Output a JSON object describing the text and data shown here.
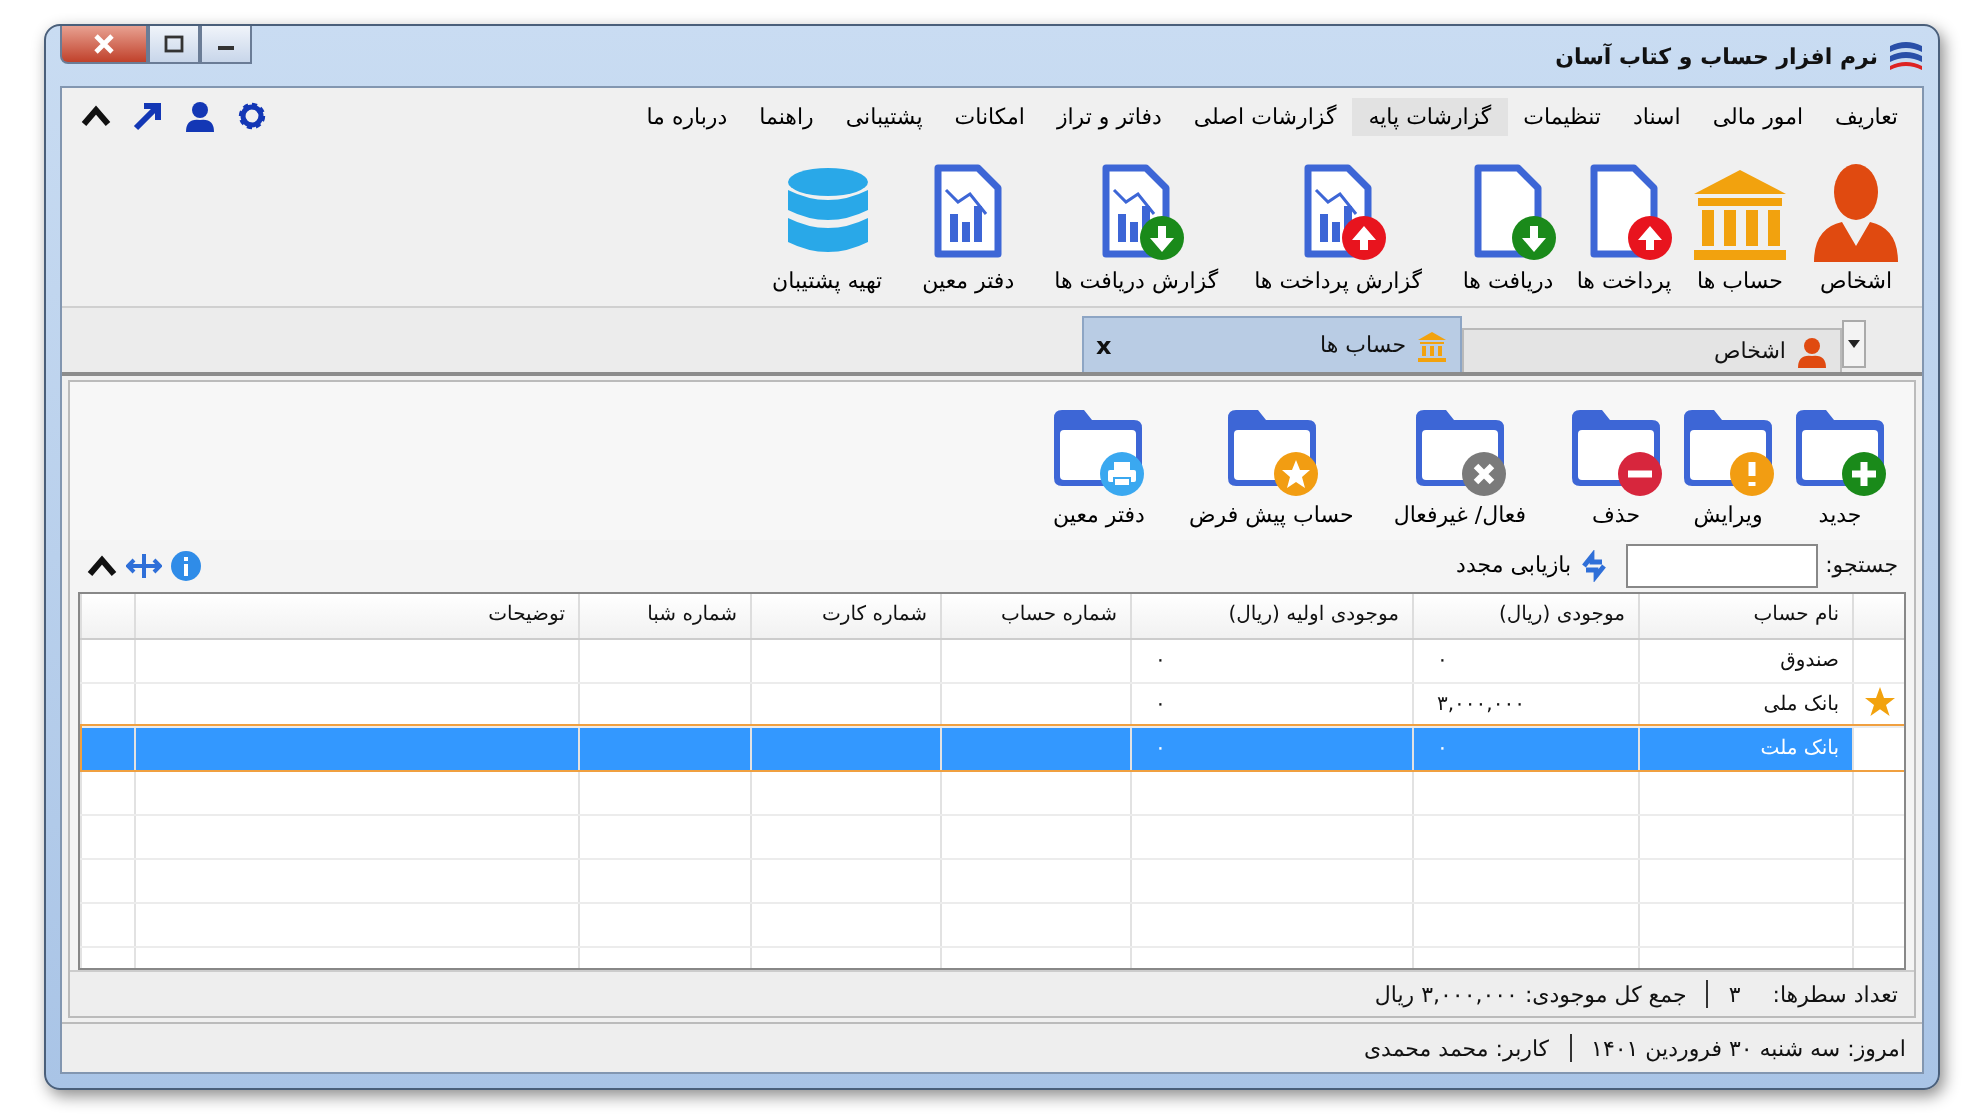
{
  "window": {
    "title": "نرم افزار حساب و کتاب آسان"
  },
  "menu": [
    {
      "label": "تعاریف",
      "selected": false
    },
    {
      "label": "امور مالی",
      "selected": false
    },
    {
      "label": "اسناد",
      "selected": false
    },
    {
      "label": "تنظیمات",
      "selected": false
    },
    {
      "label": "گزارشات پایه",
      "selected": true
    },
    {
      "label": "گزارشات اصلی",
      "selected": false
    },
    {
      "label": "دفاتر و تراز",
      "selected": false
    },
    {
      "label": "امکانات",
      "selected": false
    },
    {
      "label": "پشتیبانی",
      "selected": false
    },
    {
      "label": "راهنما",
      "selected": false
    },
    {
      "label": "درباره ما",
      "selected": false
    }
  ],
  "ribbon": [
    {
      "label": "اشخاص",
      "kind": "person"
    },
    {
      "label": "حساب ها",
      "kind": "bank"
    },
    {
      "label": "پرداخت ها",
      "kind": "doc-up"
    },
    {
      "label": "دریافت ها",
      "kind": "doc-down"
    },
    {
      "label": "گزارش پرداخت ها",
      "kind": "report-up"
    },
    {
      "label": "گزارش دریافت ها",
      "kind": "report-down"
    },
    {
      "label": "دفتر معین",
      "kind": "report"
    },
    {
      "label": "تهیه پشتیبان",
      "kind": "database"
    }
  ],
  "tabs": [
    {
      "label": "اشخاص",
      "kind": "person",
      "selected": false
    },
    {
      "label": "حساب ها",
      "kind": "bank",
      "selected": true,
      "close": "x"
    }
  ],
  "toolbar": [
    {
      "label": "جدید",
      "kind": "plus"
    },
    {
      "label": "ویرایش",
      "kind": "alert"
    },
    {
      "label": "حذف",
      "kind": "minus"
    },
    {
      "label": "فعال/ غیرفعال",
      "kind": "cross"
    },
    {
      "label": "حساب پیش فرض",
      "kind": "star"
    },
    {
      "label": "دفتر معین",
      "kind": "printer"
    }
  ],
  "search": {
    "label": "جستجو:",
    "reload": "بازیابی مجدد"
  },
  "table": {
    "columns": [
      "نام حساب",
      "موجودی (ریال)",
      "موجودی اولیه (ریال)",
      "شماره حساب",
      "شماره کارت",
      "شماره شبا",
      "توضیحات"
    ],
    "rows": [
      {
        "starred": false,
        "selected": false,
        "cells": [
          "صندوق",
          "۰",
          "۰"
        ]
      },
      {
        "starred": true,
        "selected": false,
        "cells": [
          "بانک ملی",
          "۳,۰۰۰,۰۰۰",
          "۰"
        ]
      },
      {
        "starred": false,
        "selected": true,
        "cells": [
          "بانک ملت",
          "۰",
          "۰"
        ]
      }
    ]
  },
  "summary": {
    "row_count_label": "تعداد سطرها:",
    "row_count": "۳",
    "total": "جمع کل موجودی: ۳,۰۰۰,۰۰۰ ریال"
  },
  "status_bar": {
    "date": "امروز: سه شنبه ۳۰ فروردین ۱۴۰۱",
    "user": "کاربر: محمد محمدی"
  }
}
